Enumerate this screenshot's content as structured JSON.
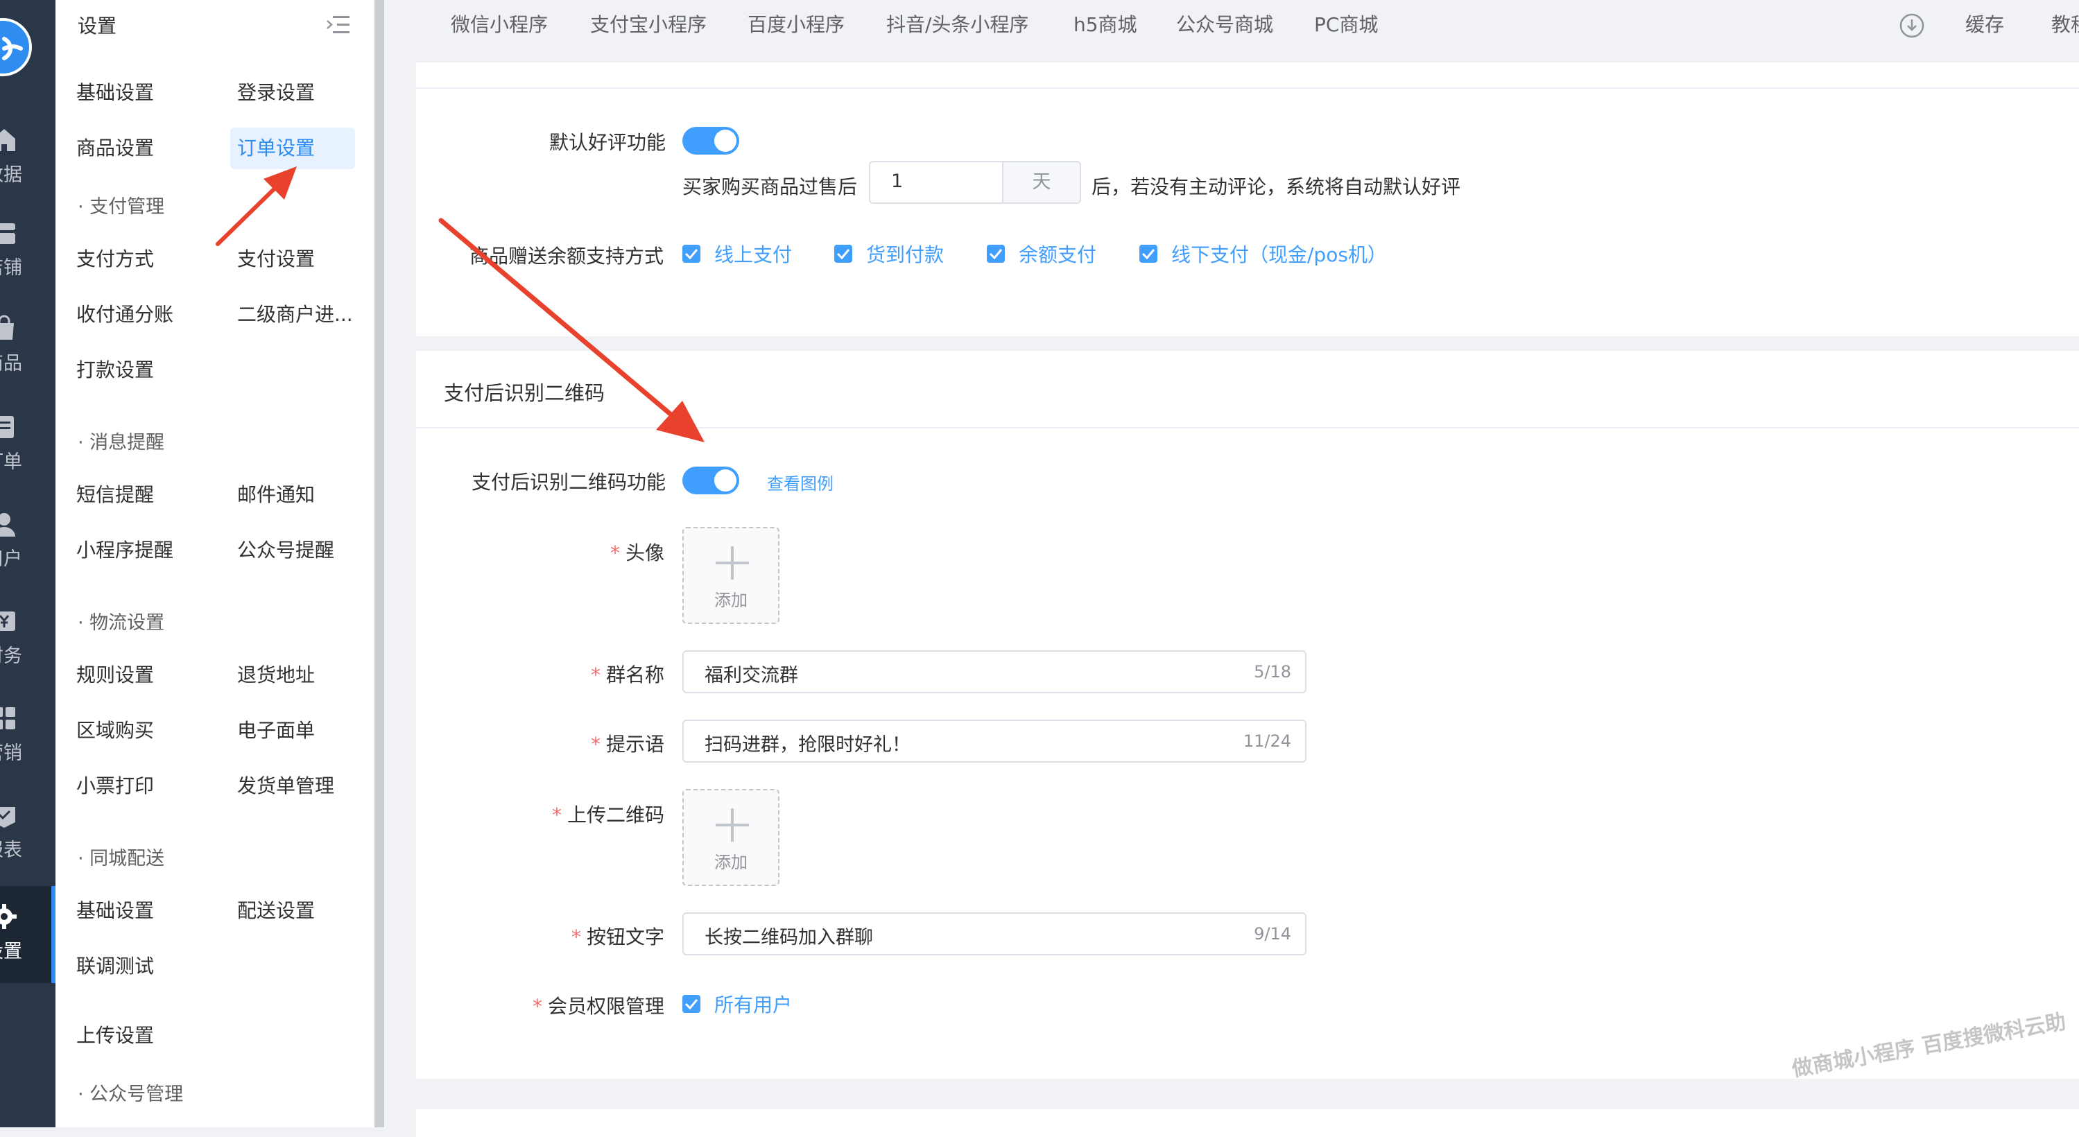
{
  "rail": {
    "items": [
      {
        "label": "数据",
        "icon": "home-icon"
      },
      {
        "label": "店铺",
        "icon": "store-icon"
      },
      {
        "label": "商品",
        "icon": "bag-icon"
      },
      {
        "label": "订单",
        "icon": "order-icon"
      },
      {
        "label": "用户",
        "icon": "user-icon"
      },
      {
        "label": "财务",
        "icon": "finance-icon"
      },
      {
        "label": "营销",
        "icon": "marketing-icon"
      },
      {
        "label": "报表",
        "icon": "report-icon"
      },
      {
        "label": "设置",
        "icon": "gear-icon",
        "active": true
      }
    ]
  },
  "sidebar": {
    "title": "设置",
    "rows": [
      {
        "left": "基础设置",
        "right": "登录设置"
      },
      {
        "left": "商品设置",
        "right": "订单设置",
        "right_active": true
      },
      {
        "group": "· 支付管理"
      },
      {
        "left": "支付方式",
        "right": "支付设置"
      },
      {
        "left": "收付通分账",
        "right": "二级商户进..."
      },
      {
        "left": "打款设置"
      },
      {
        "group": "· 消息提醒"
      },
      {
        "left": "短信提醒",
        "right": "邮件通知"
      },
      {
        "left": "小程序提醒",
        "right": "公众号提醒"
      },
      {
        "group": "· 物流设置"
      },
      {
        "left": "规则设置",
        "right": "退货地址"
      },
      {
        "left": "区域购买",
        "right": "电子面单"
      },
      {
        "left": "小票打印",
        "right": "发货单管理"
      },
      {
        "group": "· 同城配送"
      },
      {
        "left": "基础设置",
        "right": "配送设置"
      },
      {
        "left": "联调测试"
      },
      {
        "left": "上传设置"
      },
      {
        "group": "· 公众号管理"
      }
    ]
  },
  "topnav": {
    "tabs": [
      "微信小程序",
      "支付宝小程序",
      "百度小程序",
      "抖音/头条小程序",
      "h5商城",
      "公众号商城",
      "PC商城"
    ],
    "cache_label": "缓存",
    "tutorial_label": "教程"
  },
  "order_settings": {
    "default_review_label": "默认好评功能",
    "default_review_enabled": true,
    "buyer_prefix": "买家购买商品过售后",
    "days_value": "1",
    "days_unit": "天",
    "buyer_suffix": "后，若没有主动评论，系统将自动默认好评",
    "gift_label": "商品赠送余额支持方式",
    "payment_methods": [
      "线上支付",
      "货到付款",
      "余额支付",
      "线下支付（现金/pos机）"
    ]
  },
  "qr_section": {
    "title": "支付后识别二维码",
    "feature_label": "支付后识别二维码功能",
    "feature_enabled": true,
    "example_link": "查看图例",
    "avatar_label": "头像",
    "upload_text": "添加",
    "group_name_label": "群名称",
    "group_name_value": "福利交流群",
    "group_name_count": "5/18",
    "tip_label": "提示语",
    "tip_value": "扫码进群，抢限时好礼！",
    "tip_count": "11/24",
    "upload_qr_label": "上传二维码",
    "button_text_label": "按钮文字",
    "button_text_value": "长按二维码加入群聊",
    "button_text_count": "9/14",
    "member_label": "会员权限管理",
    "member_option": "所有用户"
  },
  "watermark": "做商城小程序 百度搜微科云助",
  "colors": {
    "primary": "#409eff",
    "rail_bg": "#2b3648",
    "required": "#f56c6c",
    "arrow": "#e8412c"
  }
}
